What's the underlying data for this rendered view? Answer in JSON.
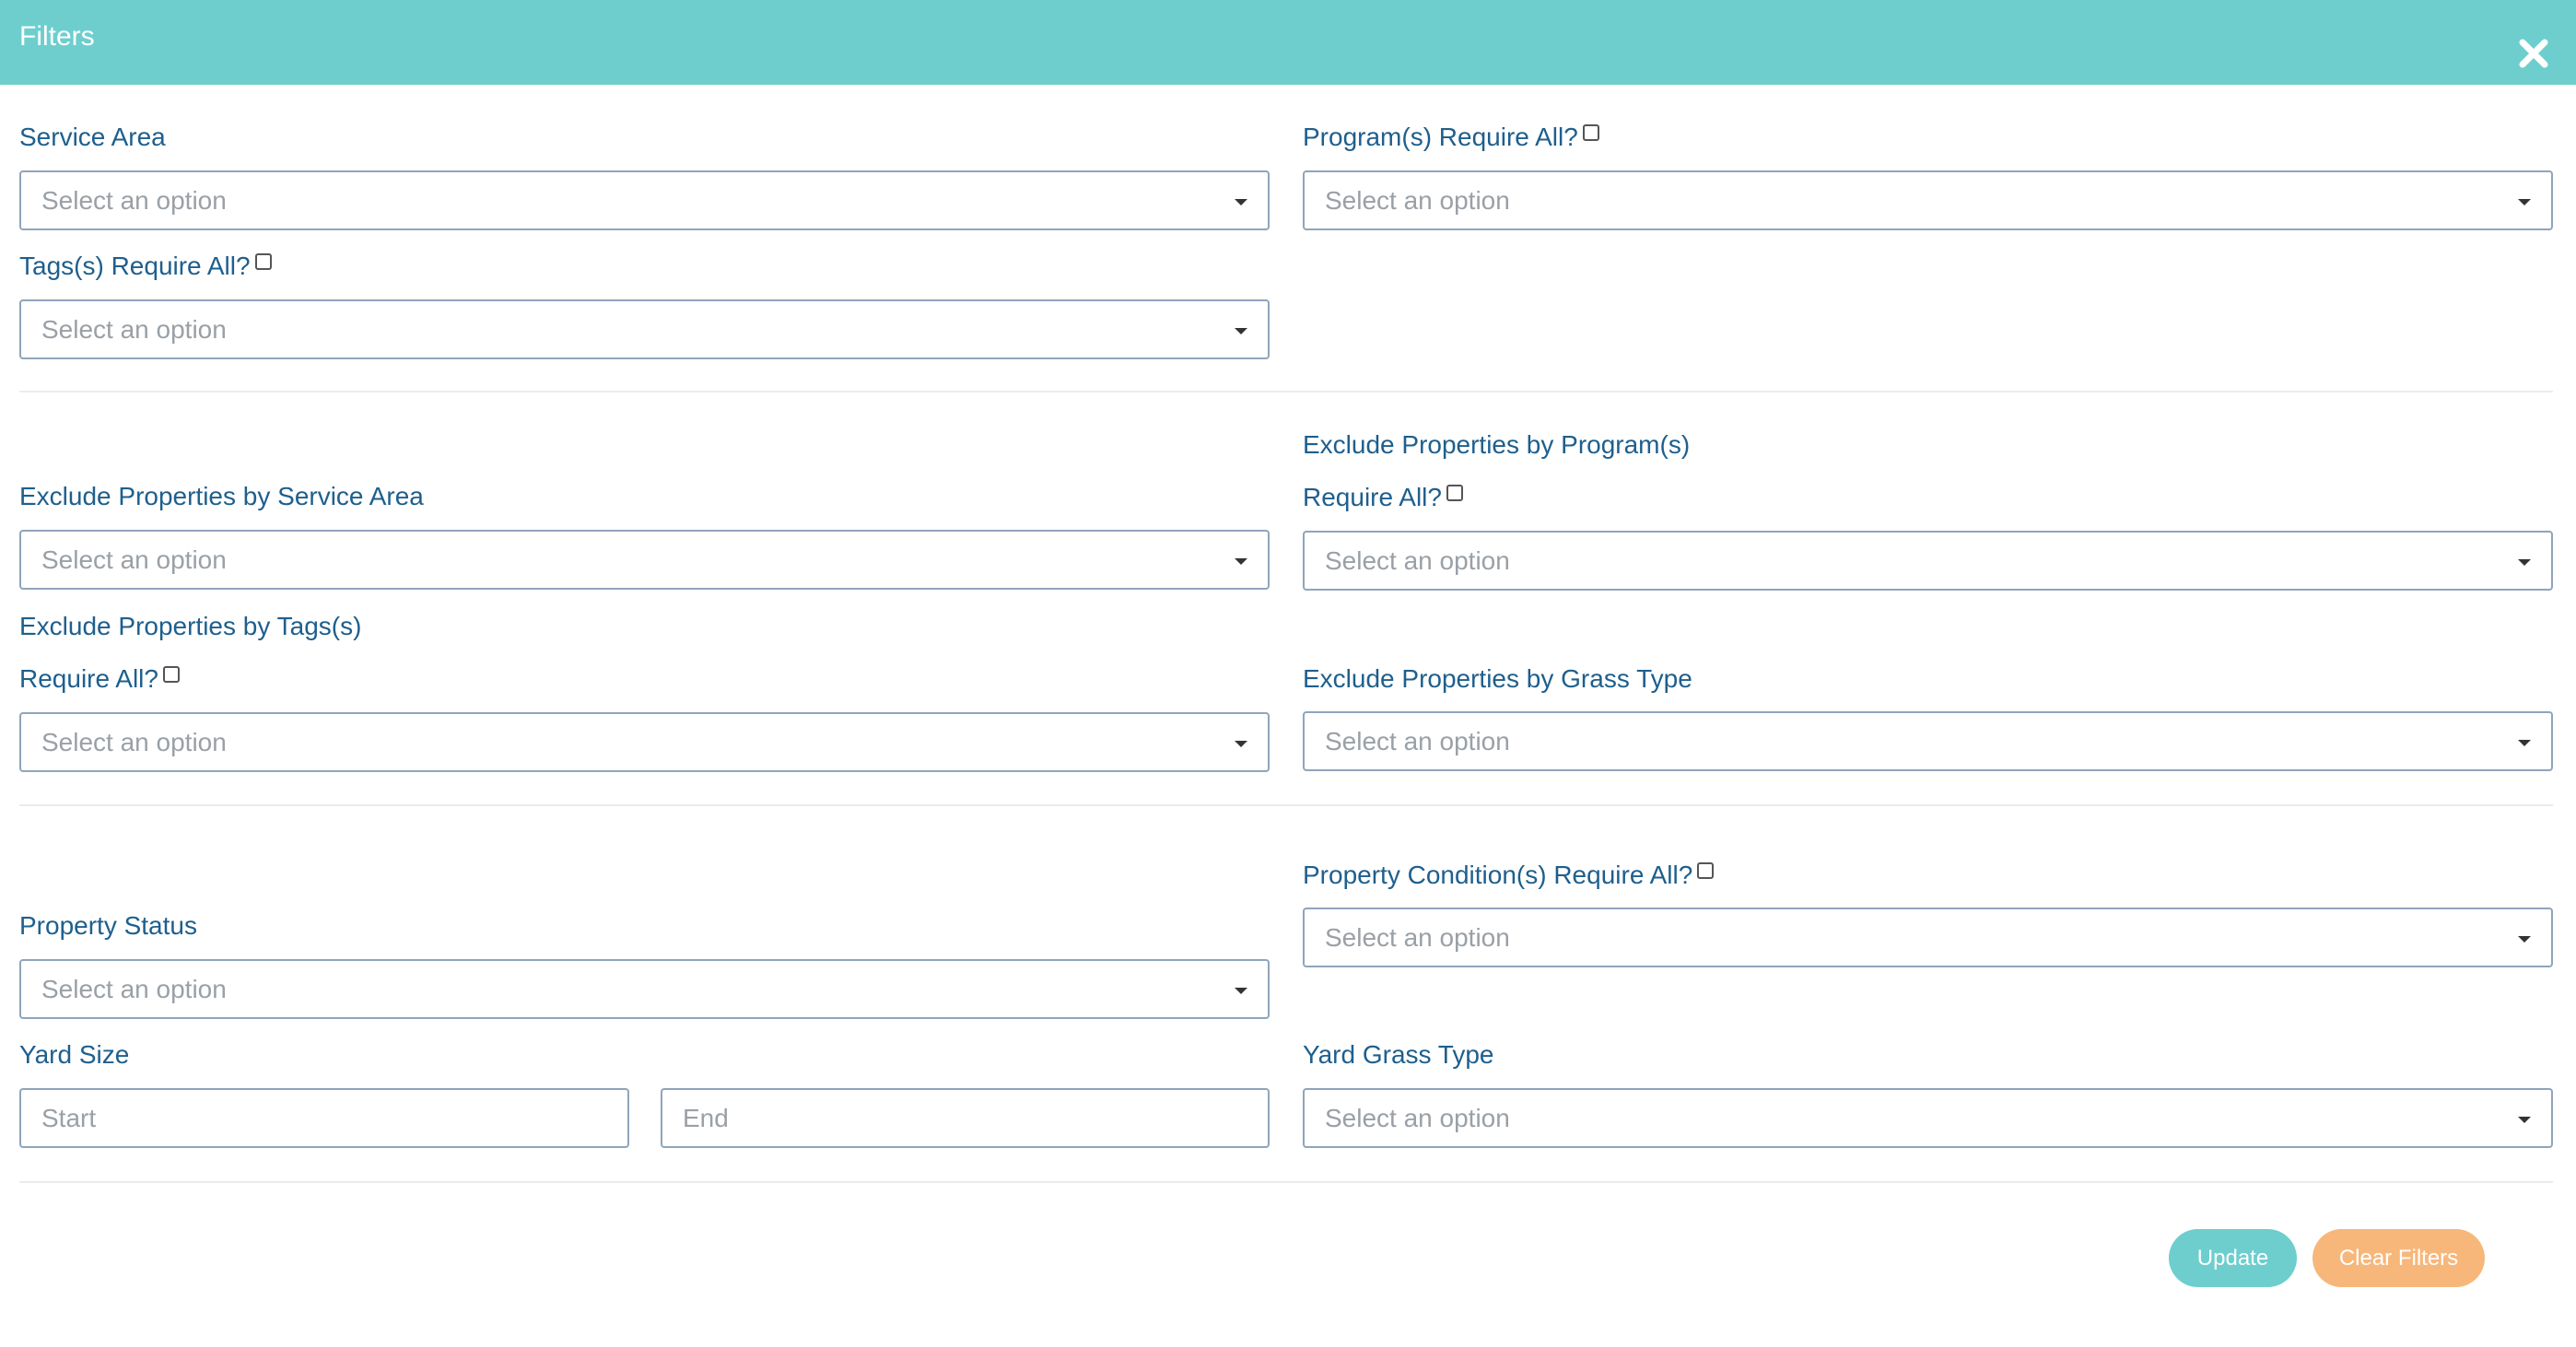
{
  "header": {
    "title": "Filters"
  },
  "labels": {
    "service_area": "Service Area",
    "programs_require_all": "Program(s) Require All?",
    "tags_require_all": "Tags(s) Require All?",
    "exclude_service_area": "Exclude Properties by Service Area",
    "exclude_programs": "Exclude Properties by Program(s)",
    "exclude_programs_require_all": "Require All?",
    "exclude_tags": "Exclude Properties by Tags(s)",
    "exclude_tags_require_all": "Require All?",
    "exclude_grass_type": "Exclude Properties by Grass Type",
    "property_condition_require_all": "Property Condition(s) Require All?",
    "property_status": "Property Status",
    "yard_size": "Yard Size",
    "yard_grass_type": "Yard Grass Type"
  },
  "placeholders": {
    "select": "Select an option",
    "start": "Start",
    "end": "End"
  },
  "buttons": {
    "update": "Update",
    "clear": "Clear Filters"
  },
  "colors": {
    "header": "#6ecece",
    "label": "#1e5f8d",
    "update_button": "#6ecece",
    "clear_button": "#f7b77a"
  }
}
